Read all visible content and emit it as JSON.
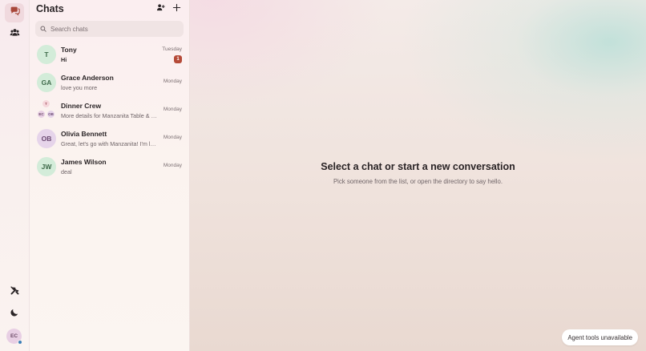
{
  "rail": {
    "items": [
      {
        "name": "chats",
        "icon": "chat-bubbles-icon",
        "active": true
      },
      {
        "name": "directory",
        "icon": "people-icon",
        "active": false
      }
    ],
    "bottom": [
      {
        "name": "tools",
        "icon": "tools-icon"
      },
      {
        "name": "theme",
        "icon": "moon-icon"
      }
    ],
    "user_initials": "EC"
  },
  "panel": {
    "title": "Chats",
    "search_placeholder": "Search chats"
  },
  "chats": [
    {
      "name": "Tony",
      "initials": "T",
      "preview": "Hi",
      "time": "Tuesday",
      "unread": "1"
    },
    {
      "name": "Grace Anderson",
      "initials": "GA",
      "preview": "love you more",
      "time": "Monday"
    },
    {
      "name": "Dinner Crew",
      "group_initials": [
        "T",
        "EC",
        "OB"
      ],
      "preview": "More details for Manzanita Table & Bar - Rese...",
      "time": "Monday"
    },
    {
      "name": "Olivia Bennett",
      "initials": "OB",
      "preview": "Great, let's go with Manzanita! I'm looking for...",
      "time": "Monday"
    },
    {
      "name": "James Wilson",
      "initials": "JW",
      "preview": "deal",
      "time": "Monday"
    }
  ],
  "main": {
    "title": "Select a chat or start a new conversation",
    "subtitle": "Pick someone from the list, or open the directory to say hello."
  },
  "agent_status": "Agent tools unavailable",
  "colors": {
    "unread_badge": "#b54a38",
    "status_dot": "#3a7fb8"
  }
}
